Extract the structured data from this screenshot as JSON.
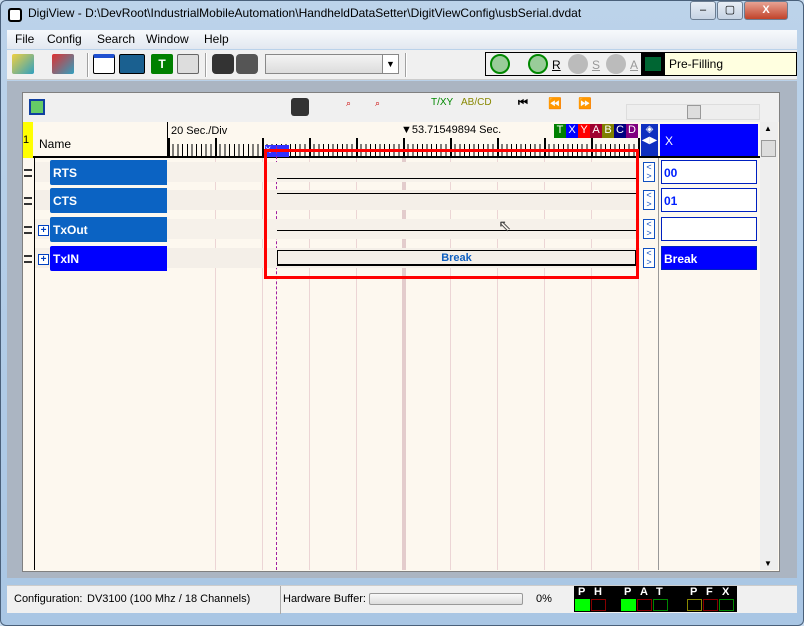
{
  "window": {
    "title": "DigiView - D:\\DevRoot\\IndustrialMobileAutomation\\HandheldDataSetter\\DigitViewConfig\\usbSerial.dvdat",
    "min": "–",
    "max": "▢",
    "close": "X"
  },
  "menu": [
    "File",
    "Config",
    "Search",
    "Window",
    "Help"
  ],
  "toolbar": {
    "combo_value": "",
    "run_labels": {
      "r": "R",
      "s": "S",
      "a": "A"
    },
    "status": "Pre-Filling"
  },
  "header": {
    "row_number": "1",
    "name_label": "Name",
    "time_div": "20 Sec./Div",
    "cursor_time": "53.71549894 Sec.",
    "markers": [
      {
        "l": "T",
        "c": "#008000"
      },
      {
        "l": "X",
        "c": "#0000ff"
      },
      {
        "l": "Y",
        "c": "#ff0000"
      },
      {
        "l": "A",
        "c": "#a00030"
      },
      {
        "l": "B",
        "c": "#808000"
      },
      {
        "l": "C",
        "c": "#000080"
      },
      {
        "l": "D",
        "c": "#800080"
      }
    ],
    "value_col": "X",
    "cursor_marker": "X"
  },
  "channels": [
    {
      "name": "RTS",
      "value": "00",
      "expandable": false
    },
    {
      "name": "CTS",
      "value": "01",
      "expandable": false
    },
    {
      "name": "TxOut",
      "value": "",
      "expandable": true
    },
    {
      "name": "TxIN",
      "value": "Break",
      "expandable": true,
      "selected": true,
      "data": "Break"
    }
  ],
  "status": {
    "config_label": "Configuration:",
    "config_value": "DV3100 (100 Mhz / 18 Channels)",
    "buffer_label": "Hardware Buffer:",
    "buffer_percent": 0,
    "buffer_text": "0%",
    "leds": [
      "P",
      "H",
      "P",
      "A",
      "T",
      "P",
      "F",
      "X"
    ]
  },
  "colors": {
    "channel": "#0b63c3",
    "selected": "#0000ff",
    "highlight": "#ff0000"
  }
}
